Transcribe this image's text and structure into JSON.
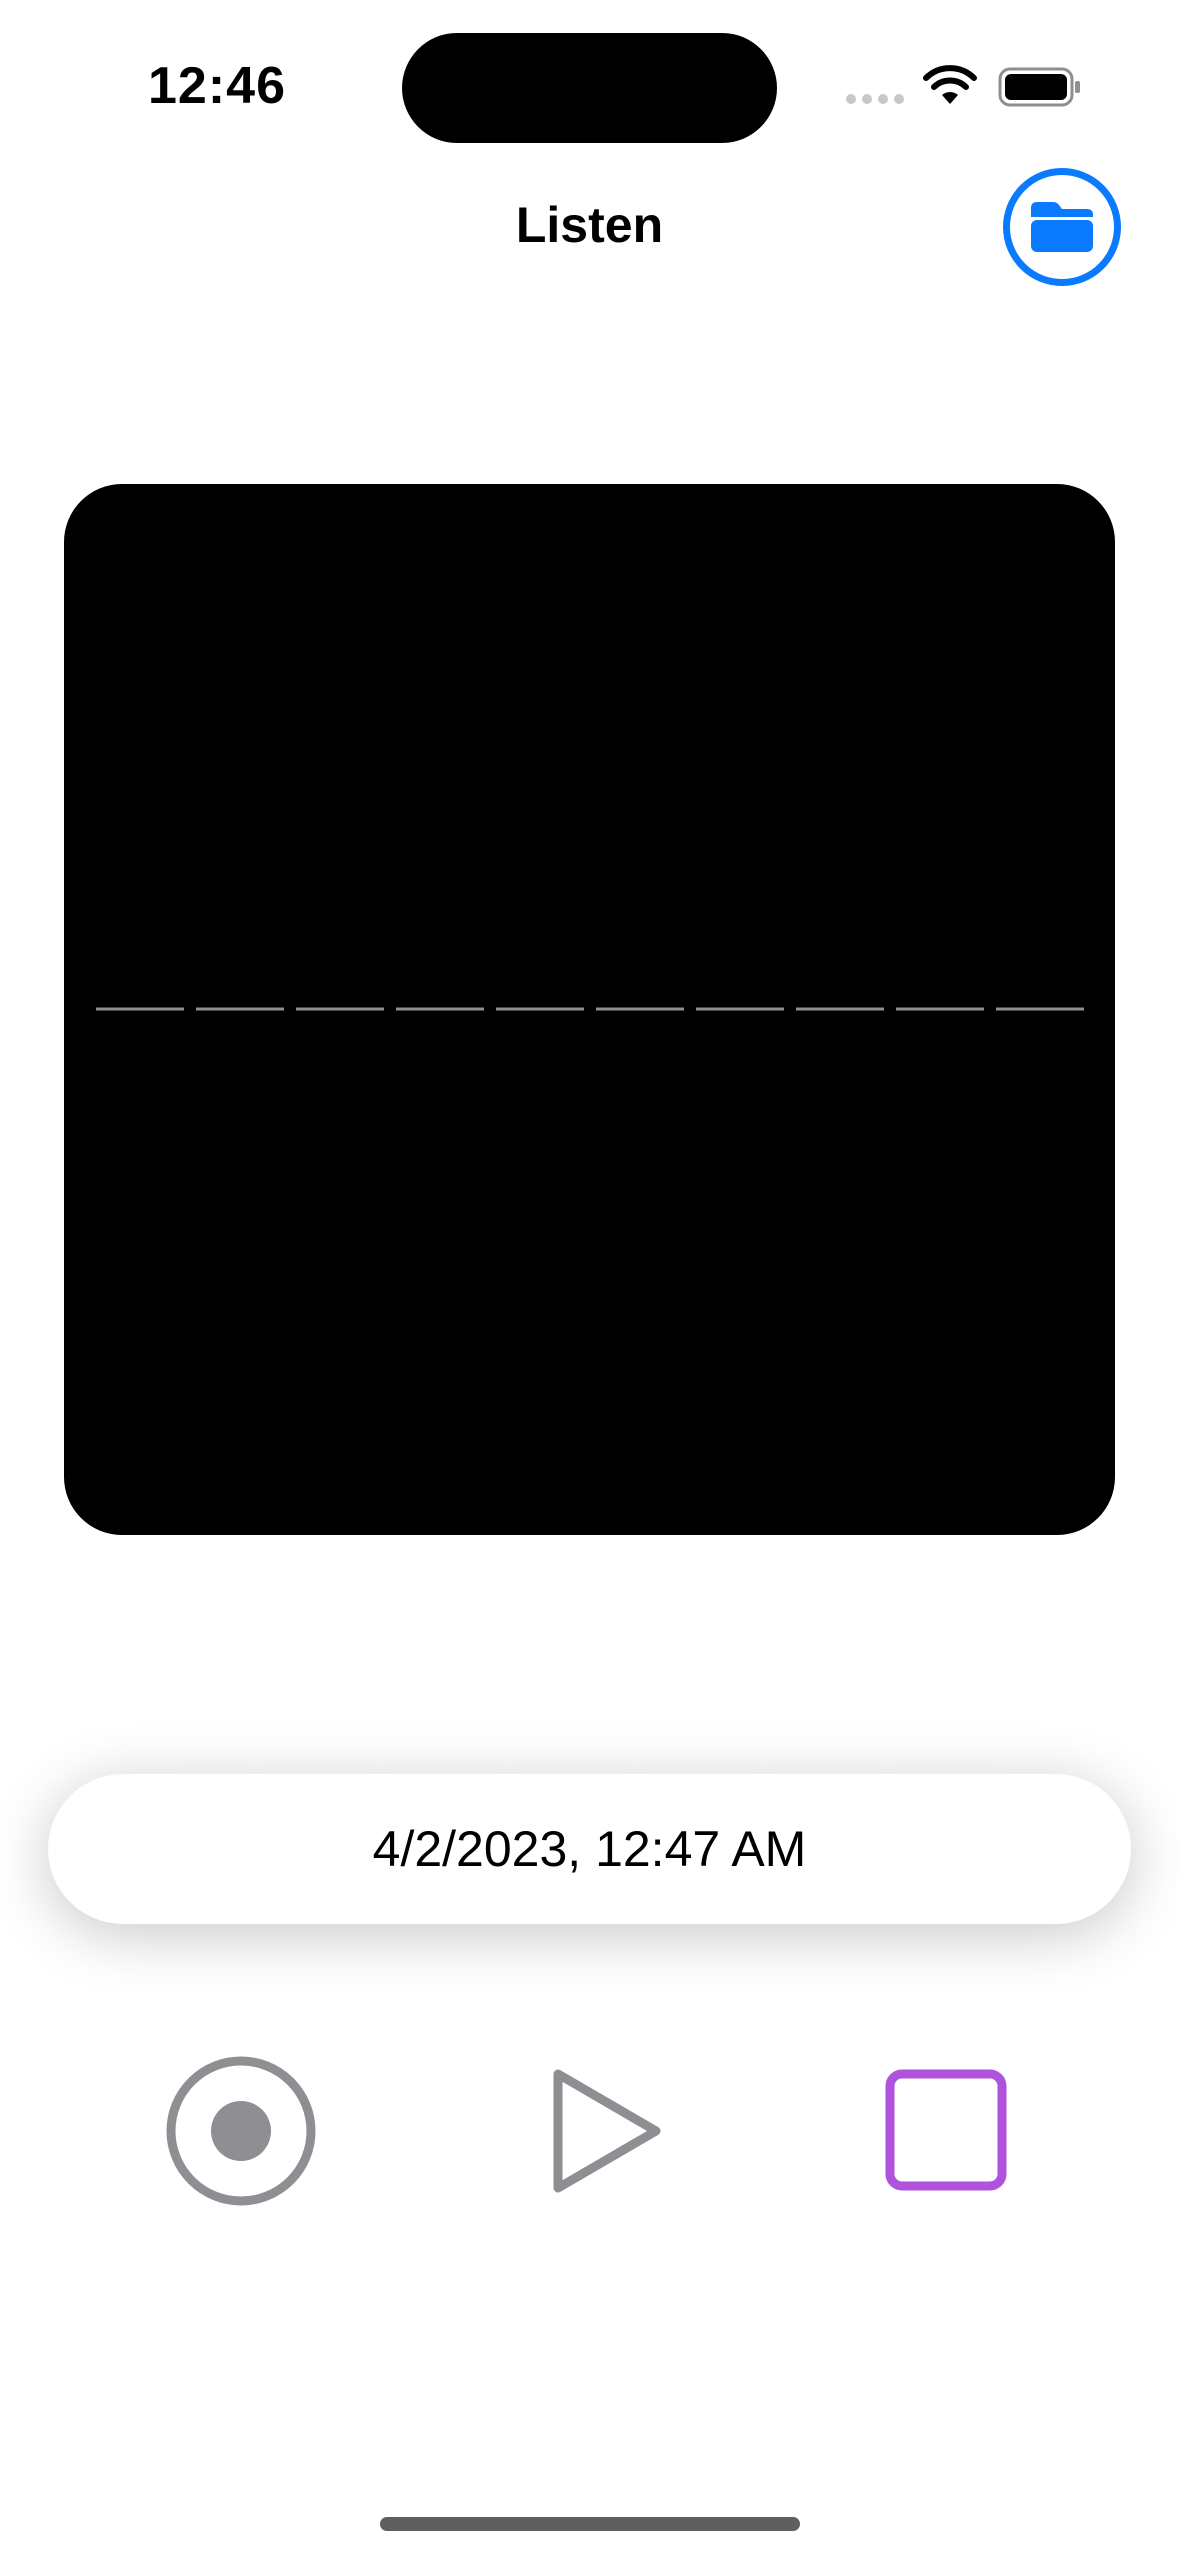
{
  "status_bar": {
    "time": "12:46"
  },
  "nav": {
    "title": "Listen",
    "folder_icon": "folder-icon"
  },
  "recording": {
    "date_label": "4/2/2023, 12:47 AM"
  },
  "controls": {
    "record_icon": "record-icon",
    "play_icon": "play-icon",
    "stop_icon": "stop-icon"
  },
  "colors": {
    "accent_blue": "#0a7aff",
    "control_gray": "#8e8e93",
    "stop_purple": "#af52de",
    "waveform_line": "#8e8e93",
    "panel_background": "#000000"
  }
}
